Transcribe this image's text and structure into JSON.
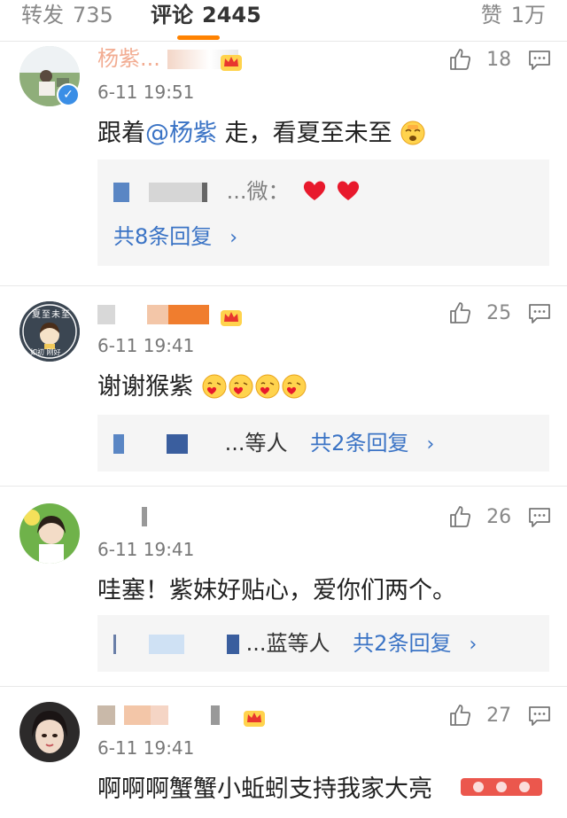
{
  "tabs": {
    "repost": {
      "label": "转发",
      "count": "735"
    },
    "comments": {
      "label": "评论",
      "count": "2445"
    },
    "likes": {
      "label": "赞",
      "count": "1万"
    }
  },
  "colors": {
    "accent": "#ff8200",
    "link": "#3a73c5",
    "username": "#e86a3a",
    "reply_bg": "#f5f5f5"
  },
  "comments": [
    {
      "username": "杨紫...",
      "timestamp": "6-11 19:51",
      "likes": "18",
      "text_before": "跟着",
      "mention": "@杨紫",
      "text_after": " 走，看夏至未至",
      "reply_preview": "...微：",
      "reply_summary": "共8条回复",
      "icons": [
        "crown-icon",
        "like-icon",
        "reply-icon",
        "verified-icon",
        "embarrassed-emoji",
        "heart-emoji"
      ]
    },
    {
      "username": "",
      "timestamp": "6-11 19:41",
      "likes": "25",
      "text": "谢谢猴紫",
      "reply_preview": "...等人",
      "reply_summary": "共2条回复",
      "avatar_text_top": "夏至未至",
      "avatar_text_bottom": "如初 刚好",
      "icons": [
        "crown-icon",
        "like-icon",
        "reply-icon",
        "kiss-emoji"
      ]
    },
    {
      "username": "",
      "timestamp": "6-11 19:41",
      "likes": "26",
      "text": "哇塞！紫妹好贴心，爱你们两个。",
      "reply_preview": "...蓝等人",
      "reply_summary": "共2条回复",
      "icons": [
        "like-icon",
        "reply-icon"
      ]
    },
    {
      "username": "",
      "timestamp": "6-11 19:41",
      "likes": "27",
      "text": "啊啊啊蟹蟹小蚯蚓支持我家大亮",
      "icons": [
        "crown-icon",
        "like-icon",
        "reply-icon"
      ]
    }
  ]
}
